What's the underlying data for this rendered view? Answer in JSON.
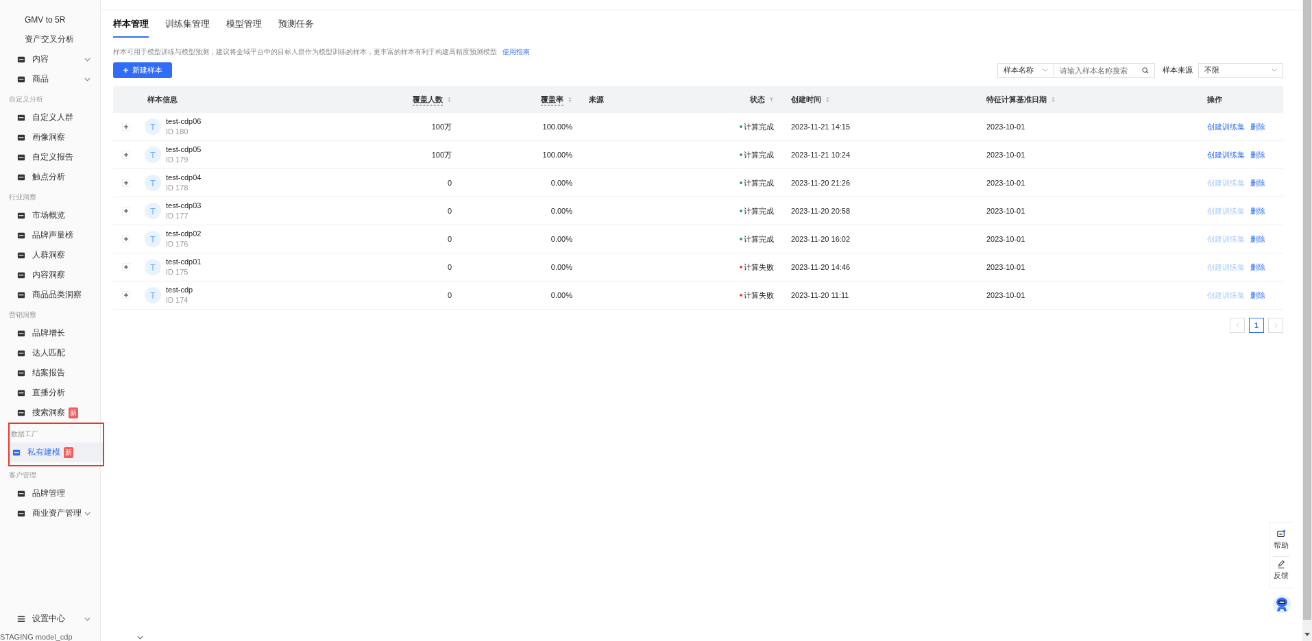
{
  "sidebar": {
    "sections": [
      {
        "highlighted": false,
        "items": [
          {
            "label": "GMV to 5R",
            "icon": false,
            "expandable": false,
            "selected": false
          },
          {
            "label": "资产交叉分析",
            "icon": false,
            "expandable": false,
            "selected": false
          },
          {
            "label": "内容",
            "icon": true,
            "expandable": true,
            "selected": false
          },
          {
            "label": "商品",
            "icon": true,
            "expandable": true,
            "selected": false
          }
        ]
      },
      {
        "label": "自定义分析",
        "highlighted": false,
        "items": [
          {
            "label": "自定义人群",
            "icon": true,
            "expandable": false,
            "selected": false
          },
          {
            "label": "画像洞察",
            "icon": true,
            "expandable": false,
            "selected": false
          },
          {
            "label": "自定义报告",
            "icon": true,
            "expandable": false,
            "selected": false
          },
          {
            "label": "触点分析",
            "icon": true,
            "expandable": false,
            "selected": false
          }
        ]
      },
      {
        "label": "行业洞察",
        "highlighted": false,
        "items": [
          {
            "label": "市场概览",
            "icon": true,
            "expandable": false,
            "selected": false
          },
          {
            "label": "品牌声量榜",
            "icon": true,
            "expandable": false,
            "selected": false
          },
          {
            "label": "人群洞察",
            "icon": true,
            "expandable": false,
            "selected": false
          },
          {
            "label": "内容洞察",
            "icon": true,
            "expandable": false,
            "selected": false
          },
          {
            "label": "商品品类洞察",
            "icon": true,
            "expandable": false,
            "selected": false
          }
        ]
      },
      {
        "label": "营销洞察",
        "highlighted": false,
        "items": [
          {
            "label": "品牌增长",
            "icon": true,
            "expandable": false,
            "selected": false
          },
          {
            "label": "达人匹配",
            "icon": true,
            "expandable": false,
            "selected": false
          },
          {
            "label": "结案报告",
            "icon": true,
            "expandable": false,
            "selected": false
          },
          {
            "label": "直播分析",
            "icon": true,
            "expandable": false,
            "selected": false
          },
          {
            "label": "搜索洞察",
            "icon": true,
            "expandable": false,
            "selected": false,
            "badge": "新"
          }
        ]
      },
      {
        "label": "数据工厂",
        "highlighted": true,
        "items": [
          {
            "label": "私有建模",
            "icon": true,
            "expandable": false,
            "selected": true,
            "badge": "新"
          }
        ]
      },
      {
        "label": "客户管理",
        "highlighted": false,
        "items": [
          {
            "label": "品牌管理",
            "icon": true,
            "expandable": false,
            "selected": false
          },
          {
            "label": "商业资产管理",
            "icon": true,
            "expandable": true,
            "selected": false
          }
        ]
      }
    ],
    "settings": {
      "label": "设置中心",
      "expandable": true
    },
    "environment": "STAGING model_cdp"
  },
  "tabs": [
    {
      "label": "样本管理",
      "selected": true
    },
    {
      "label": "训练集管理",
      "selected": false
    },
    {
      "label": "模型管理",
      "selected": false
    },
    {
      "label": "预测任务",
      "selected": false
    }
  ],
  "description": "样本可用于模型训练与模型预测，建议将全域平台中的目标人群作为模型训练的样本，更丰富的样本有利于构建高精度预测模型",
  "guide_link": "使用指南",
  "new_button": "新建样本",
  "filters": {
    "search_field": "样本名称",
    "search_placeholder": "请输入样本名称搜索",
    "source_label": "样本来源",
    "source_value": "不限"
  },
  "table": {
    "columns": [
      {
        "label": "样本信息",
        "kind": "plain",
        "hint": false
      },
      {
        "label": "覆盖人数",
        "kind": "sort",
        "hint": true
      },
      {
        "label": "覆盖率",
        "kind": "sort",
        "hint": true
      },
      {
        "label": "来源",
        "kind": "plain",
        "hint": false
      },
      {
        "label": "状态",
        "kind": "filter",
        "hint": false
      },
      {
        "label": "创建时间",
        "kind": "sort",
        "hint": false
      },
      {
        "label": "特征计算基准日期",
        "kind": "sort",
        "hint": false
      },
      {
        "label": "操作",
        "kind": "plain",
        "hint": false
      }
    ],
    "rows": [
      {
        "avatar": "T",
        "name": "test-cdp06",
        "id": "ID 180",
        "coverage": "100万",
        "rate": "100.00%",
        "status": "计算完成",
        "color": "#22a35a",
        "created": "2023-11-21 14:15",
        "base_date": "2023-10-01",
        "create_action": "创建训练集",
        "create_disabled": false,
        "delete_action": "删除"
      },
      {
        "avatar": "T",
        "name": "test-cdp05",
        "id": "ID 179",
        "coverage": "100万",
        "rate": "100.00%",
        "status": "计算完成",
        "color": "#22a35a",
        "created": "2023-11-21 10:24",
        "base_date": "2023-10-01",
        "create_action": "创建训练集",
        "create_disabled": false,
        "delete_action": "删除"
      },
      {
        "avatar": "T",
        "name": "test-cdp04",
        "id": "ID 178",
        "coverage": "0",
        "rate": "0.00%",
        "status": "计算完成",
        "color": "#22a35a",
        "created": "2023-11-20 21:26",
        "base_date": "2023-10-01",
        "create_action": "创建训练集",
        "create_disabled": true,
        "delete_action": "删除"
      },
      {
        "avatar": "T",
        "name": "test-cdp03",
        "id": "ID 177",
        "coverage": "0",
        "rate": "0.00%",
        "status": "计算完成",
        "color": "#22a35a",
        "created": "2023-11-20 20:58",
        "base_date": "2023-10-01",
        "create_action": "创建训练集",
        "create_disabled": true,
        "delete_action": "删除"
      },
      {
        "avatar": "T",
        "name": "test-cdp02",
        "id": "ID 176",
        "coverage": "0",
        "rate": "0.00%",
        "status": "计算完成",
        "color": "#22a35a",
        "created": "2023-11-20 16:02",
        "base_date": "2023-10-01",
        "create_action": "创建训练集",
        "create_disabled": true,
        "delete_action": "删除"
      },
      {
        "avatar": "T",
        "name": "test-cdp01",
        "id": "ID 175",
        "coverage": "0",
        "rate": "0.00%",
        "status": "计算失败",
        "color": "#f5372a",
        "created": "2023-11-20 14:46",
        "base_date": "2023-10-01",
        "create_action": "创建训练集",
        "create_disabled": true,
        "delete_action": "删除"
      },
      {
        "avatar": "T",
        "name": "test-cdp",
        "id": "ID 174",
        "coverage": "0",
        "rate": "0.00%",
        "status": "计算失败",
        "color": "#f5372a",
        "created": "2023-11-20 11:11",
        "base_date": "2023-10-01",
        "create_action": "创建训练集",
        "create_disabled": true,
        "delete_action": "删除"
      }
    ]
  },
  "pagination": {
    "prev_disabled": true,
    "next_disabled": true,
    "pages": [
      {
        "label": "1",
        "selected": true
      }
    ]
  },
  "float_tools": [
    {
      "label": "帮助",
      "kind": "help"
    },
    {
      "label": "反馈",
      "kind": "feedback"
    }
  ]
}
